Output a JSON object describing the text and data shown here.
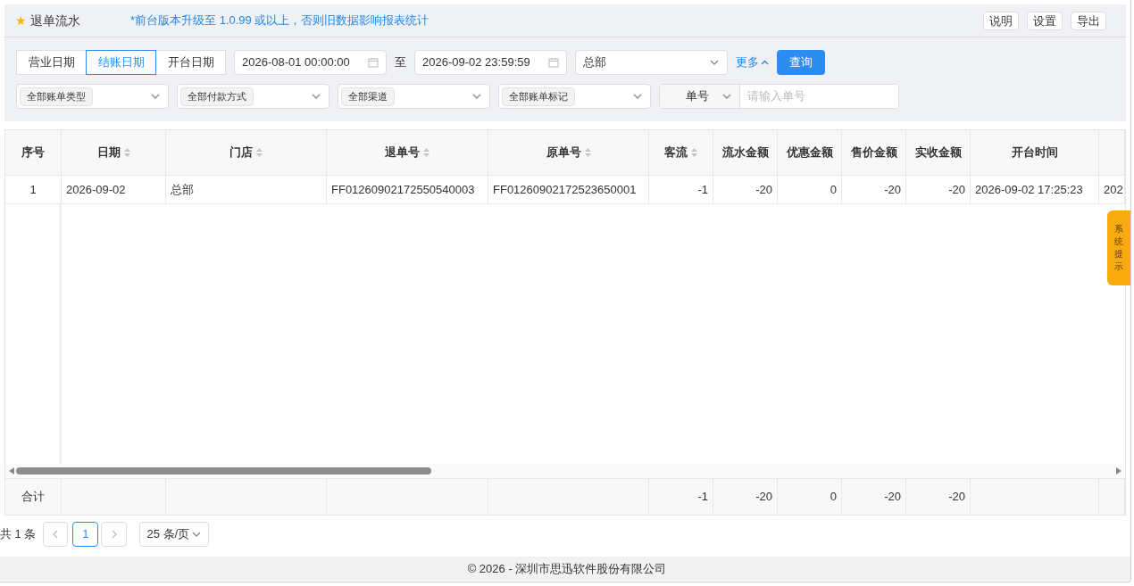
{
  "header": {
    "icon": "★",
    "title": "退单流水",
    "notice": "*前台版本升级至 1.0.99 或以上，否则旧数据影响报表统计",
    "buttons": [
      "说明",
      "设置",
      "导出"
    ]
  },
  "filters": {
    "date_types": [
      {
        "label": "营业日期",
        "selected": false
      },
      {
        "label": "结账日期",
        "selected": true
      },
      {
        "label": "开台日期",
        "selected": false
      }
    ],
    "start": "2026-08-01 00:00:00",
    "range_sep": "至",
    "end": "2026-09-02 23:59:59",
    "store": "总部",
    "more": "更多",
    "query": "查询",
    "selects": [
      "全部账单类型",
      "全部付款方式",
      "全部渠道",
      "全部账单标记"
    ],
    "number_type": "单号",
    "number_placeholder": "请输入单号"
  },
  "table": {
    "columns": [
      {
        "label": "序号",
        "sortable": false,
        "kind": "index"
      },
      {
        "label": "日期",
        "sortable": true,
        "kind": "text"
      },
      {
        "label": "门店",
        "sortable": true,
        "kind": "text"
      },
      {
        "label": "退单号",
        "sortable": true,
        "kind": "text"
      },
      {
        "label": "原单号",
        "sortable": true,
        "kind": "text"
      },
      {
        "label": "客流",
        "sortable": true,
        "kind": "number",
        "total": "-1"
      },
      {
        "label": "流水金额",
        "sortable": false,
        "kind": "number",
        "total": "-20"
      },
      {
        "label": "优惠金额",
        "sortable": false,
        "kind": "number",
        "total": "0"
      },
      {
        "label": "售价金额",
        "sortable": false,
        "kind": "number",
        "total": "-20"
      },
      {
        "label": "实收金额",
        "sortable": false,
        "kind": "number",
        "total": "-20"
      },
      {
        "label": "开台时间",
        "sortable": false,
        "kind": "text"
      },
      {
        "sortable": false,
        "kind": "text"
      }
    ],
    "rows": [
      [
        "1",
        "2026-09-02",
        "总部",
        "FF01260902172550540003",
        "FF01260902172523650001",
        "-1",
        "-20",
        "0",
        "-20",
        "-20",
        "2026-09-02 17:25:23",
        "202"
      ]
    ],
    "totals_label": "合计"
  },
  "pagination": {
    "total": "共 1 条",
    "pages": [
      {
        "label": "1",
        "selected": true
      }
    ],
    "page_size": "25 条/页"
  },
  "side_tab": "系统提示",
  "footer": "© 2026 - 深圳市思迅软件股份有限公司"
}
